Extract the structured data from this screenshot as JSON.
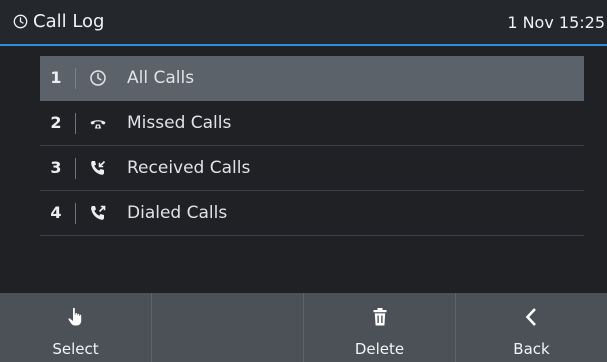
{
  "header": {
    "title": "Call Log",
    "datetime": "1 Nov 15:25"
  },
  "menu": {
    "items": [
      {
        "number": "1",
        "label": "All Calls",
        "icon": "clock-icon",
        "selected": true
      },
      {
        "number": "2",
        "label": "Missed Calls",
        "icon": "missed-call-icon",
        "selected": false
      },
      {
        "number": "3",
        "label": "Received Calls",
        "icon": "received-call-icon",
        "selected": false
      },
      {
        "number": "4",
        "label": "Dialed Calls",
        "icon": "dialed-call-icon",
        "selected": false
      }
    ]
  },
  "softkeys": [
    {
      "label": "Select",
      "icon": "hand-pointer-icon"
    },
    {
      "label": "",
      "icon": ""
    },
    {
      "label": "Delete",
      "icon": "trash-icon"
    },
    {
      "label": "Back",
      "icon": "chevron-left-icon"
    }
  ],
  "colors": {
    "background": "#1f2125",
    "header_accent": "#2f8ed9",
    "selected_row": "#5b626a",
    "softkey_bar": "#4b5157"
  }
}
